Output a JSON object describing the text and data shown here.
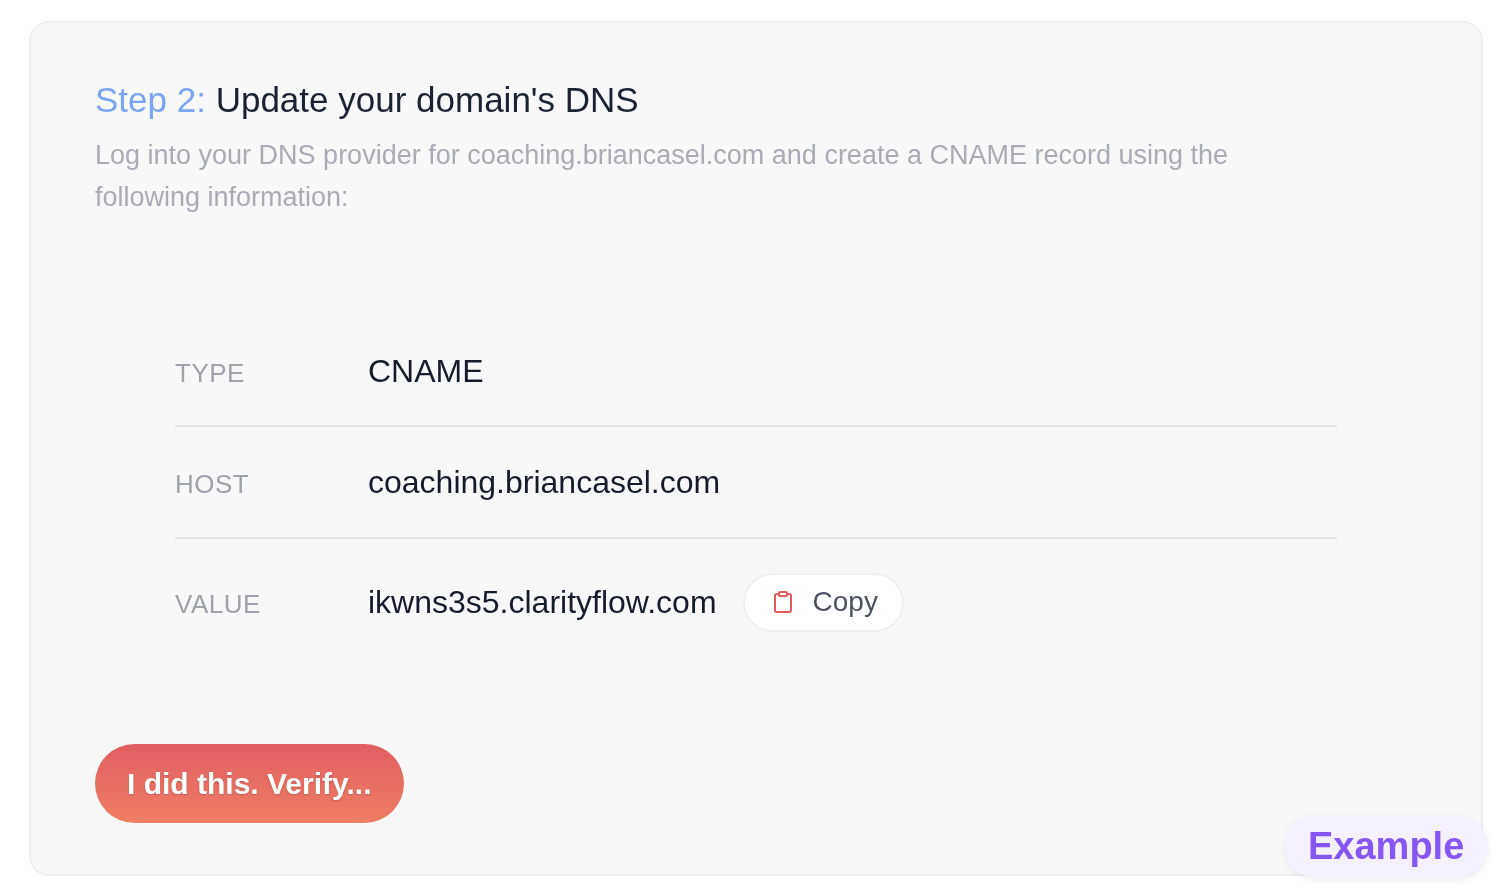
{
  "header": {
    "step_label": "Step 2:",
    "title": "Update your domain's DNS",
    "description": "Log into your DNS provider for coaching.briancasel.com and create a CNAME record using the following information:"
  },
  "records": [
    {
      "label": "TYPE",
      "value": "CNAME"
    },
    {
      "label": "HOST",
      "value": "coaching.briancasel.com"
    },
    {
      "label": "VALUE",
      "value": "ikwns3s5.clarityflow.com",
      "copy_button": "Copy"
    }
  ],
  "verify_button": "I did this. Verify...",
  "badge": "Example"
}
